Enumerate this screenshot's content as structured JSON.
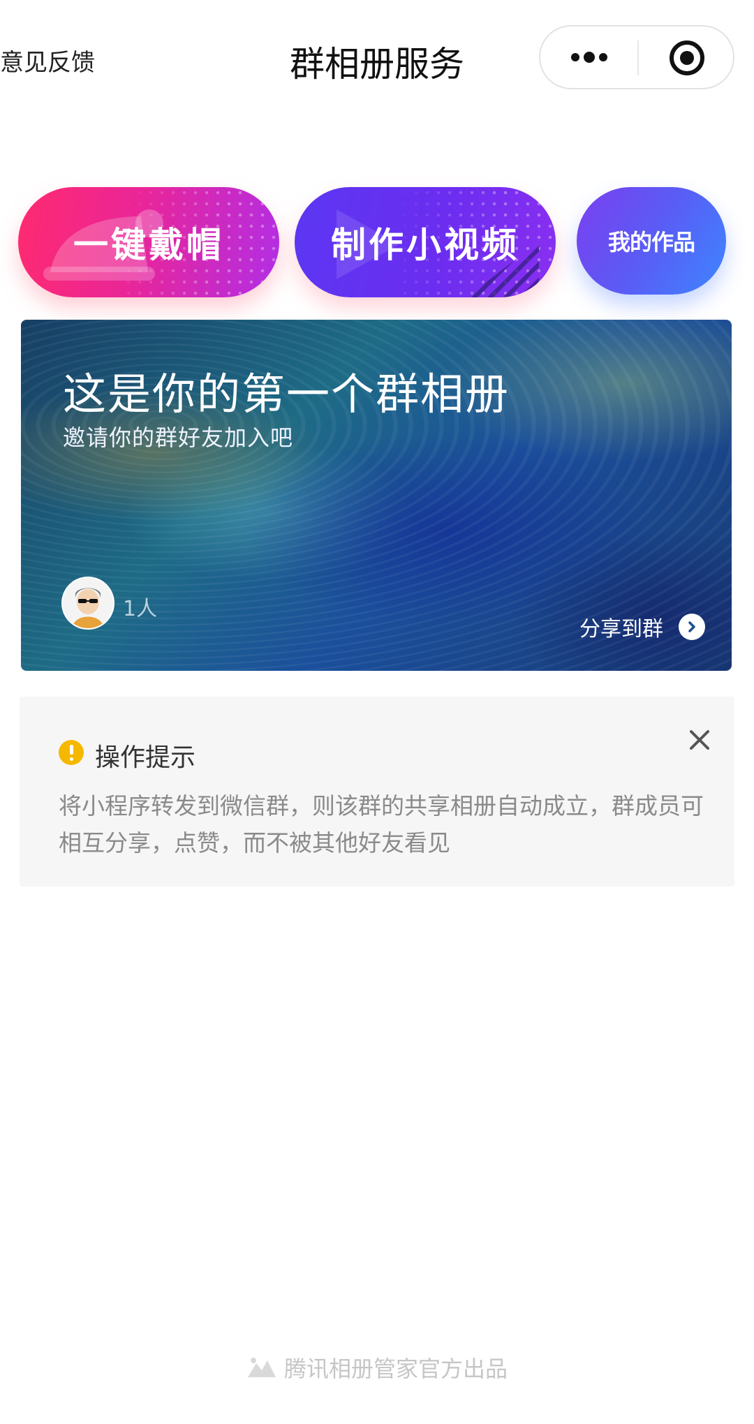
{
  "header": {
    "feedback_label": "意见反馈",
    "title": "群相册服务",
    "more_icon": "more-dots-icon",
    "close_icon": "target-close-icon"
  },
  "features": {
    "hat_label": "一键戴帽",
    "video_label": "制作小视频",
    "works_label": "我的作品"
  },
  "album": {
    "title": "这是你的第一个群相册",
    "subtitle": "邀请你的群好友加入吧",
    "member_count": "1人",
    "share_label": "分享到群"
  },
  "tip": {
    "title": "操作提示",
    "text": "将小程序转发到微信群，则该群的共享相册自动成立，群成员可相互分享，点赞，而不被其他好友看见",
    "icon": "warning-icon",
    "close_icon": "close-icon"
  },
  "footer": {
    "text": "腾讯相册管家官方出品",
    "icon": "mountain-logo-icon"
  },
  "colors": {
    "accent_pink": "#ff2a6f",
    "accent_purple": "#5b37f2",
    "accent_blue": "#3d86ff",
    "warn_yellow": "#f5b800"
  }
}
